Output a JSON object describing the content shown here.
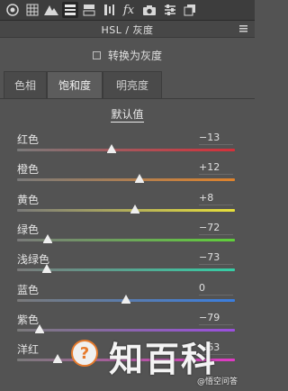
{
  "toolbar": {
    "icons": [
      "aperture-icon",
      "grid-icon",
      "mountain-icon",
      "hsl-panel-icon",
      "split-toning-icon",
      "lens-icon",
      "fx-icon",
      "camera-icon",
      "sliders-icon",
      "presets-icon"
    ]
  },
  "panel": {
    "title": "HSL / 灰度",
    "convert_to_gray_label": "转换为灰度",
    "tabs": [
      {
        "label": "色相",
        "active": false
      },
      {
        "label": "饱和度",
        "active": true
      },
      {
        "label": "明亮度",
        "active": false
      }
    ],
    "defaults_label": "默认值"
  },
  "sliders": [
    {
      "label": "红色",
      "value": "−13",
      "norm": 0.435,
      "gradient": [
        "#7a7a7a",
        "#d6303a"
      ]
    },
    {
      "label": "橙色",
      "value": "+12",
      "norm": 0.56,
      "gradient": [
        "#7a7a7a",
        "#e0832c"
      ]
    },
    {
      "label": "黄色",
      "value": "+8",
      "norm": 0.54,
      "gradient": [
        "#7a7a7a",
        "#e8e03a"
      ]
    },
    {
      "label": "绿色",
      "value": "−72",
      "norm": 0.14,
      "gradient": [
        "#7a7a7a",
        "#5fd03a"
      ]
    },
    {
      "label": "浅绿色",
      "value": "−73",
      "norm": 0.135,
      "gradient": [
        "#7a7a7a",
        "#35cfa6"
      ]
    },
    {
      "label": "蓝色",
      "value": "0",
      "norm": 0.5,
      "gradient": [
        "#7a7a7a",
        "#3a7ee0"
      ]
    },
    {
      "label": "紫色",
      "value": "−79",
      "norm": 0.105,
      "gradient": [
        "#7a7a7a",
        "#9b4fe0"
      ]
    },
    {
      "label": "洋红",
      "value": "−63",
      "norm": 0.185,
      "gradient": [
        "#7a7a7a",
        "#e03ac4"
      ]
    }
  ],
  "watermark": {
    "brand": "知百科",
    "subtext": "@悟空问答",
    "logo_glyph": "?"
  },
  "colors": {
    "background": "#535353",
    "toolbar": "#3d3d3d",
    "watermark_orange": "#e77b2d"
  }
}
